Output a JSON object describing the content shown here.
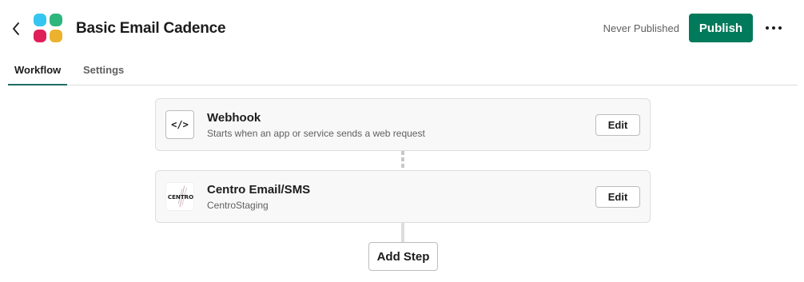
{
  "header": {
    "title": "Basic Email Cadence",
    "status": "Never Published",
    "publish_label": "Publish",
    "icons": {
      "back": "chevron-left-icon",
      "logo": "app-logo",
      "more": "more-horizontal-icon"
    }
  },
  "tabs": [
    {
      "label": "Workflow",
      "active": true
    },
    {
      "label": "Settings",
      "active": false
    }
  ],
  "steps": [
    {
      "title": "Webhook",
      "subtitle": "Starts when an app or service sends a web request",
      "icon": "code-icon",
      "icon_text": "</>",
      "edit_label": "Edit"
    },
    {
      "title": "Centro Email/SMS",
      "subtitle": "CentroStaging",
      "icon": "centro-logo-icon",
      "icon_text": "CENTRO",
      "edit_label": "Edit"
    }
  ],
  "add_step_label": "Add Step",
  "colors": {
    "primary": "#007a5a",
    "tab_underline": "#1e6b63",
    "text": "#1d1c1d",
    "muted": "#616061"
  }
}
